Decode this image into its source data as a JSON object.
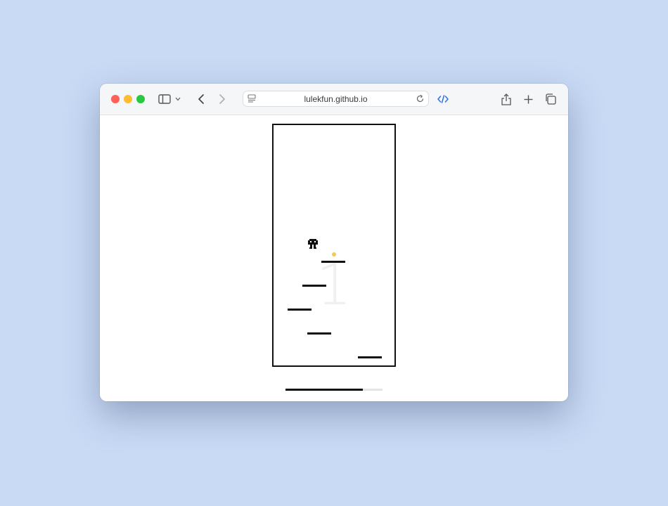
{
  "browser": {
    "url": "lulekfun.github.io",
    "toolbar_icons": [
      "sidebar-icon",
      "chevron-down-icon",
      "back-icon",
      "forward-icon",
      "page-menu-icon",
      "reload-icon",
      "devtools-icon",
      "share-icon",
      "new-tab-icon",
      "tabs-overview-icon"
    ],
    "traffic_lights": {
      "close": "#fe5f57",
      "minimize": "#febc2e",
      "zoom": "#28c840"
    }
  },
  "game": {
    "score": "1",
    "colors": {
      "platform": "#111111",
      "coin": "#f6c75a",
      "background_score": "#f0f0f0",
      "page_bg": "#c9daf5"
    },
    "progress": 0.8
  }
}
